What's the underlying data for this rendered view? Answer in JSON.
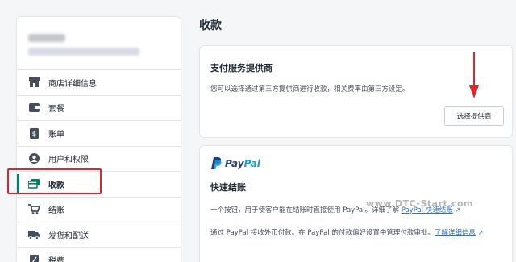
{
  "sidebar": {
    "items": [
      {
        "label": "商店详细信息",
        "icon": "store-icon"
      },
      {
        "label": "套餐",
        "icon": "plan-icon"
      },
      {
        "label": "账单",
        "icon": "dollar-icon"
      },
      {
        "label": "用户和权限",
        "icon": "user-icon"
      },
      {
        "label": "收款",
        "icon": "payments-icon",
        "active": true
      },
      {
        "label": "结账",
        "icon": "cart-icon"
      },
      {
        "label": "发货和配送",
        "icon": "truck-icon"
      },
      {
        "label": "税费",
        "icon": "tax-icon"
      }
    ]
  },
  "page": {
    "title": "收款"
  },
  "provider_card": {
    "title": "支付服务提供商",
    "description": "您可以选择通过第三方提供商进行收款，相关费率由第三方设定。",
    "button_label": "选择提供商"
  },
  "paypal_card": {
    "logo_pay": "Pay",
    "logo_pal": "Pal",
    "title": "快速结账",
    "para1_text": "一个按钮，用于使客户能在结账时直接使用 PayPal。详细了解 ",
    "para1_link": "PayPal 快速结账",
    "para2_text": "通过 PayPal 接收外币付款。在 PayPal 的付款偏好设置中管理付款审批。",
    "para2_link": "了解详细信息"
  },
  "watermark": "www.DTC-Start.com",
  "colors": {
    "accent": "#008060",
    "highlight": "#e0242f",
    "link": "#2c6ecb"
  }
}
